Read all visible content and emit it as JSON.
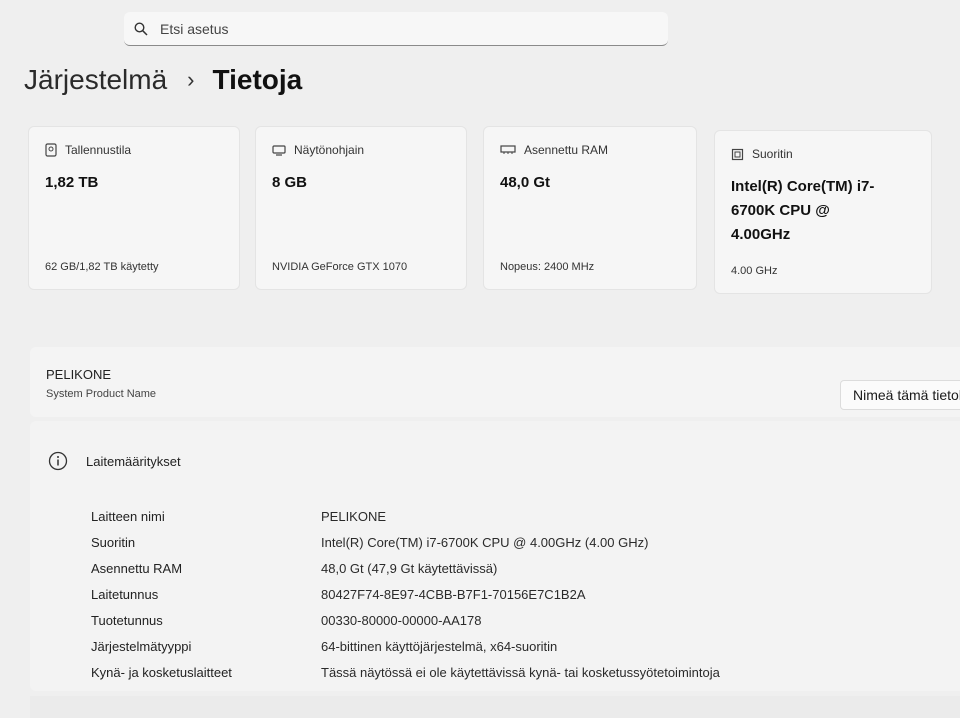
{
  "search": {
    "placeholder": "Etsi asetus"
  },
  "breadcrumb": {
    "parent": "Järjestelmä",
    "separator": "›",
    "current": "Tietoja"
  },
  "cards": [
    {
      "icon": "storage-icon",
      "label": "Tallennustila",
      "value": "1,82 TB",
      "sub": "62 GB/1,82 TB käytetty"
    },
    {
      "icon": "gpu-icon",
      "label": "Näytönohjain",
      "value": "8 GB",
      "sub": "NVIDIA GeForce GTX 1070"
    },
    {
      "icon": "ram-icon",
      "label": "Asennettu RAM",
      "value": "48,0 Gt",
      "sub": "Nopeus: 2400 MHz"
    },
    {
      "icon": "cpu-icon",
      "label": "Suoritin",
      "value": "Intel(R) Core(TM) i7-6700K CPU @ 4.00GHz",
      "sub": "4.00 GHz"
    }
  ],
  "device": {
    "name": "PELIKONE",
    "name_sub": "System Product Name",
    "rename_label": "Nimeä tämä tietokone"
  },
  "specs": {
    "title": "Laitemääritykset",
    "rows": [
      {
        "key": "Laitteen nimi",
        "value": "PELIKONE"
      },
      {
        "key": "Suoritin",
        "value": "Intel(R) Core(TM) i7-6700K CPU @ 4.00GHz (4.00 GHz)"
      },
      {
        "key": "Asennettu RAM",
        "value": "48,0 Gt (47,9 Gt käytettävissä)"
      },
      {
        "key": "Laitetunnus",
        "value": "80427F74-8E97-4CBB-B7F1-70156E7C1B2A"
      },
      {
        "key": "Tuotetunnus",
        "value": "00330-80000-00000-AA178"
      },
      {
        "key": "Järjestelmätyyppi",
        "value": "64-bittinen käyttöjärjestelmä, x64-suoritin"
      },
      {
        "key": "Kynä- ja kosketuslaitteet",
        "value": "Tässä näytössä ei ole käytettävissä kynä- tai kosketussyötetoimintoja"
      }
    ]
  }
}
